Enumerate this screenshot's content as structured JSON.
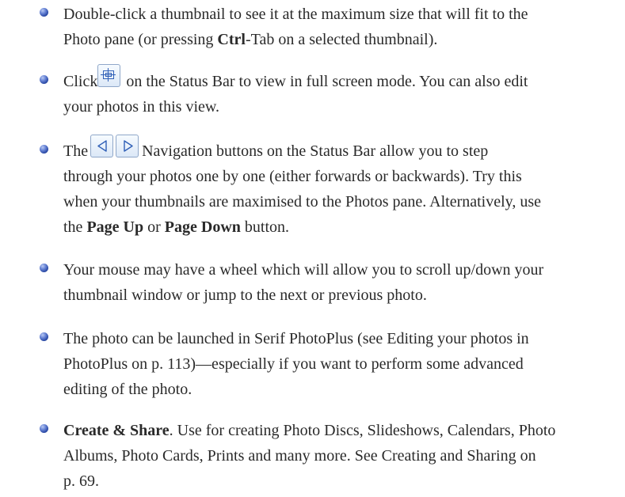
{
  "bullets": [
    {
      "line1_a": "Double-click a thumbnail to see it at the maximum size that will fit to the",
      "line2_a": "Photo pane (or pressing ",
      "line2_b": "Ctrl",
      "line2_c": "-Tab on a selected thumbnail)."
    },
    {
      "line1_a": "Click",
      "icon": "full-screen-icon",
      "line1_b": " on the Status Bar to view in full screen mode. You can also edit",
      "line2_a": "your photos in this view."
    },
    {
      "line1_a": "The",
      "icon_prev": "previous-arrow-icon",
      "icon_next": "next-arrow-icon",
      "line1_b": "Navigation buttons on the Status Bar allow you to step",
      "line2_a": "through your photos one by one (either forwards or backwards). Try this",
      "line3_a": "when your thumbnails are maximised to the Photos pane. Alternatively, use",
      "line4_a": "the ",
      "line4_b": "Page Up",
      "line4_c": " or ",
      "line4_d": "Page Down",
      "line4_e": " button."
    },
    {
      "line1_a": "Your mouse may have a wheel which will allow you to scroll up/down your",
      "line2_a": "thumbnail window or jump to the next or previous photo."
    },
    {
      "line1_a": "The photo can be launched in Serif PhotoPlus (see Editing your photos in",
      "line2_a": "PhotoPlus on p. 113)—especially if you want to perform some advanced",
      "line3_a": "editing of the photo."
    },
    {
      "line1_a": "Create & Share",
      "line1_b": ". Use for creating Photo Discs, Slideshows, Calendars, Photo",
      "line2_a": "Albums, Photo Cards, Prints and many more. See Creating and Sharing on",
      "line3_a": "p. 69."
    }
  ],
  "colors": {
    "text": "#2a2a2a",
    "bullet": "#3d5fc4",
    "icon_blue": "#2f5fb7"
  }
}
